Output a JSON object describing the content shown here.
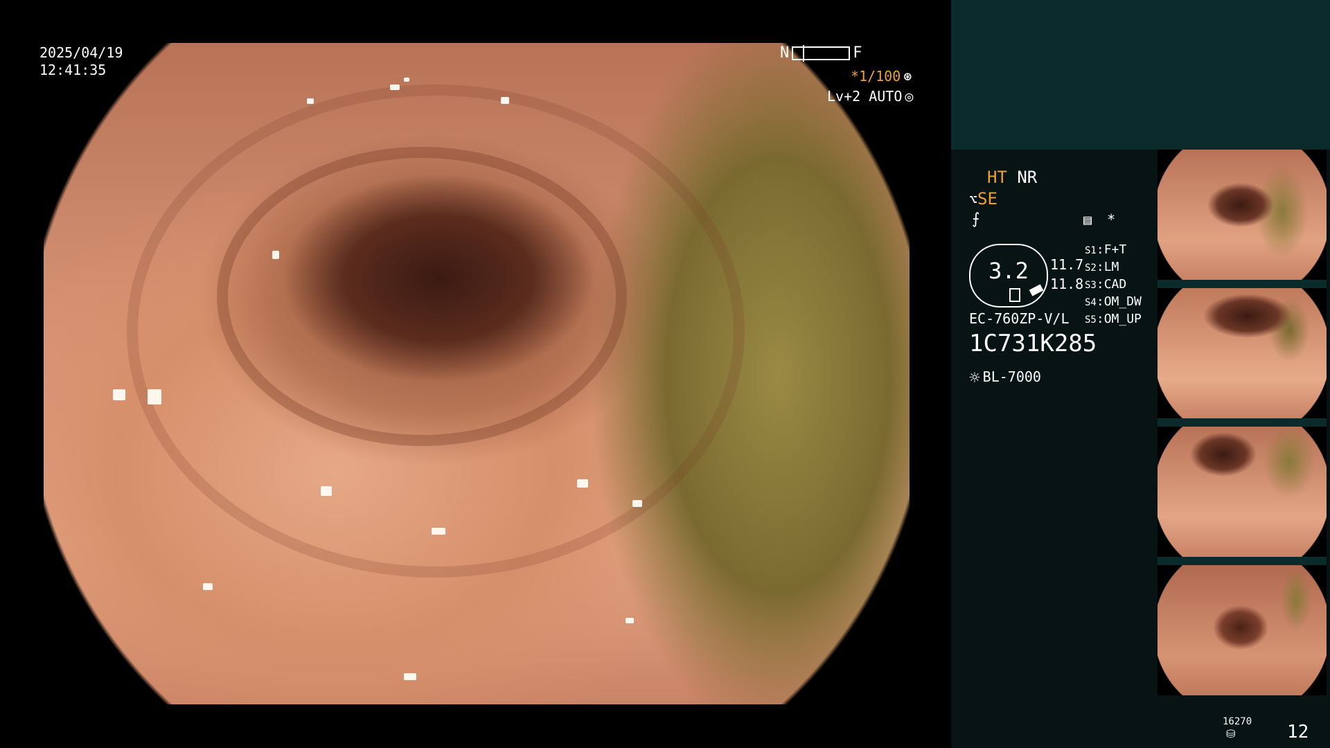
{
  "overlay": {
    "date": "2025/04/19",
    "time": "12:41:35",
    "near_label": "N",
    "far_label": "F",
    "shutter": "*1/100",
    "shutter_icon": "aperture-icon",
    "level": "Lv+2 AUTO",
    "level_icon": "iris-icon"
  },
  "panel": {
    "ht_label": "HT",
    "nr_label": "NR",
    "se_label": "SE",
    "memo_symbol": "*",
    "gauge_value": "3.2",
    "gauge_num_1": "11.7",
    "gauge_num_2": "11.8",
    "settings": [
      {
        "key": "S1",
        "value": "F+T"
      },
      {
        "key": "S2",
        "value": "LM"
      },
      {
        "key": "S3",
        "value": "CAD"
      },
      {
        "key": "S4",
        "value": "OM_DW"
      },
      {
        "key": "S5",
        "value": "OM_UP"
      }
    ],
    "model": "EC-760ZP-V/L",
    "serial": "1C731K285",
    "light_source": "BL-7000",
    "counter_small": "16270",
    "counter_big": "12"
  },
  "colors": {
    "accent_orange": "#f0a030",
    "panel_bg": "#081414",
    "panel_top_bg": "#0a2a2c"
  }
}
